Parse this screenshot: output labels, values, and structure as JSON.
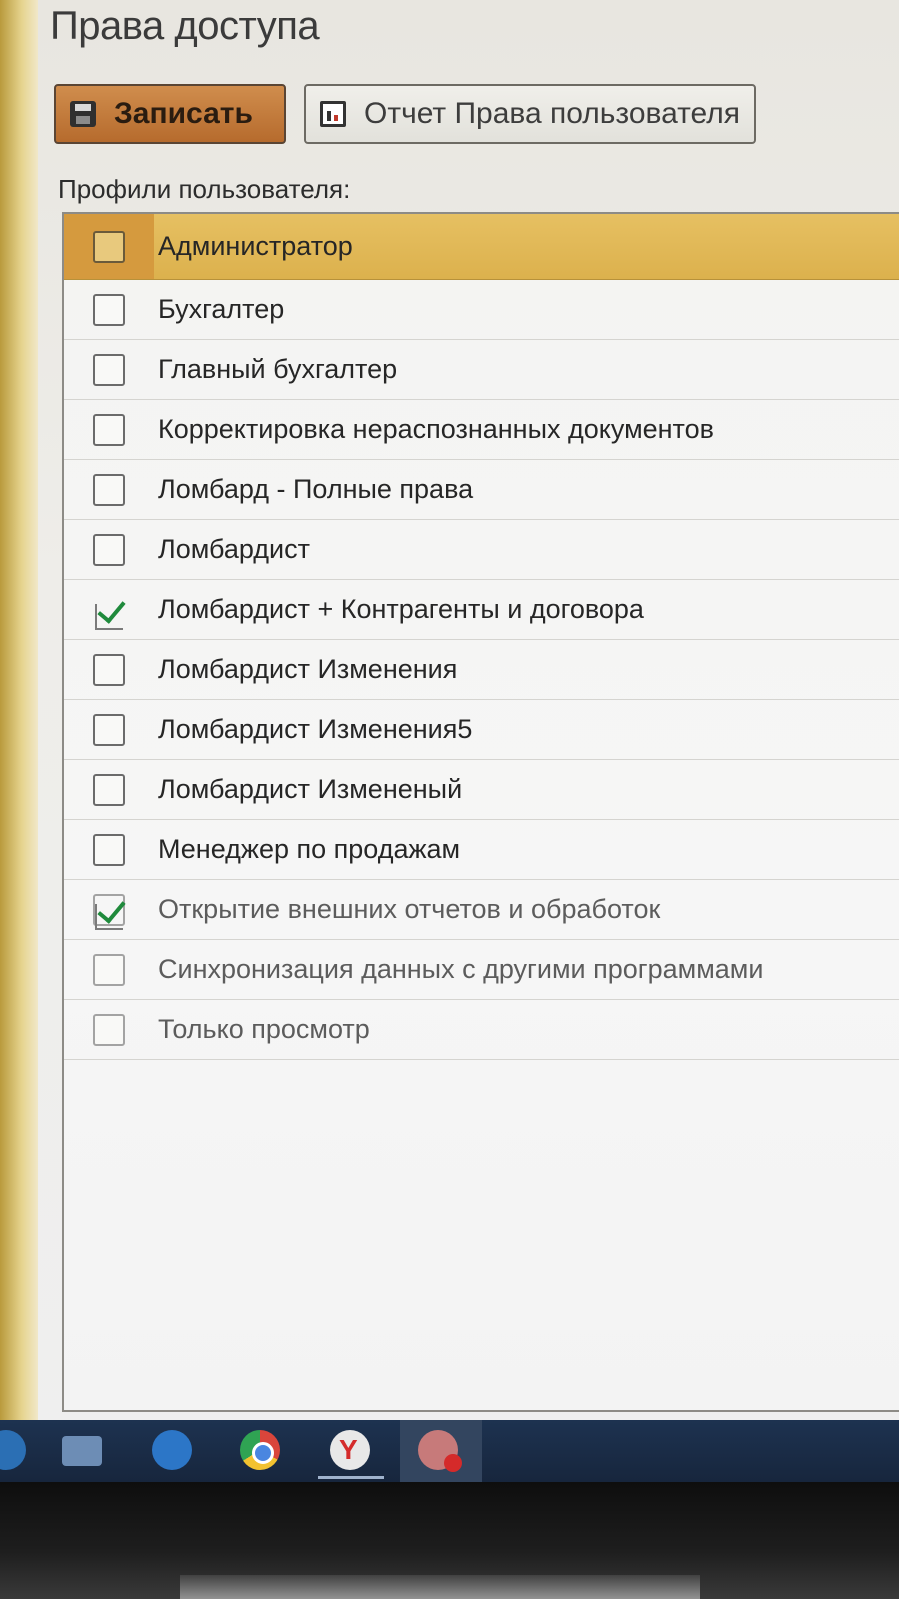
{
  "window": {
    "title": "Права доступа"
  },
  "toolbar": {
    "save_label": "Записать",
    "report_label": "Отчет Права пользователя"
  },
  "profiles": {
    "label": "Профили пользователя:",
    "items": [
      {
        "label": "Администратор",
        "checked": false,
        "selected": true
      },
      {
        "label": "Бухгалтер",
        "checked": false
      },
      {
        "label": "Главный бухгалтер",
        "checked": false
      },
      {
        "label": "Корректировка нераспознанных документов",
        "checked": false
      },
      {
        "label": "Ломбард - Полные права",
        "checked": false
      },
      {
        "label": "Ломбардист",
        "checked": false
      },
      {
        "label": "Ломбардист + Контрагенты и договора",
        "checked": true
      },
      {
        "label": "Ломбардист Изменения",
        "checked": false
      },
      {
        "label": "Ломбардист Изменения5",
        "checked": false
      },
      {
        "label": "Ломбардист Измененый",
        "checked": false
      },
      {
        "label": "Менеджер по продажам",
        "checked": false
      },
      {
        "label": "Открытие внешних отчетов и обработок",
        "checked": true
      },
      {
        "label": "Синхронизация данных с другими программами",
        "checked": false
      },
      {
        "label": "Только просмотр",
        "checked": false
      }
    ]
  },
  "taskbar": {
    "icons": [
      "edge-icon",
      "file-explorer-icon",
      "1c-icon",
      "chrome-icon",
      "yandex-browser-icon",
      "app-icon"
    ]
  },
  "colors": {
    "accent_selected": "#dcb14d",
    "save_button": "#c27a3a",
    "checkmark": "#1f8a3c"
  }
}
